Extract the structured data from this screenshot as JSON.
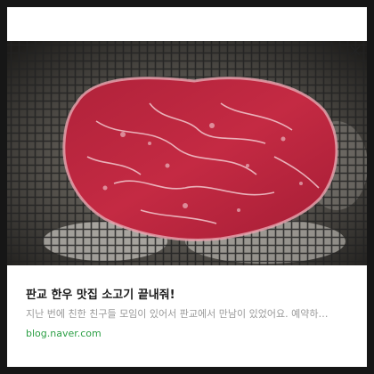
{
  "popup": {
    "close_icon": "close-icon",
    "image": "marbled-beef-steak-on-grill"
  },
  "card": {
    "title": "판교 한우 맛집 소고기 끝내줘!",
    "description": "지난 번에 친한 친구들 모임이 있어서 판교에서 만남이 있었어요. 예약하…",
    "domain": "blog.naver.com"
  },
  "colors": {
    "background": "#161616",
    "card": "#ffffff",
    "title": "#1a1a1a",
    "description": "#9a9a9a",
    "domain": "#2c9f45"
  }
}
